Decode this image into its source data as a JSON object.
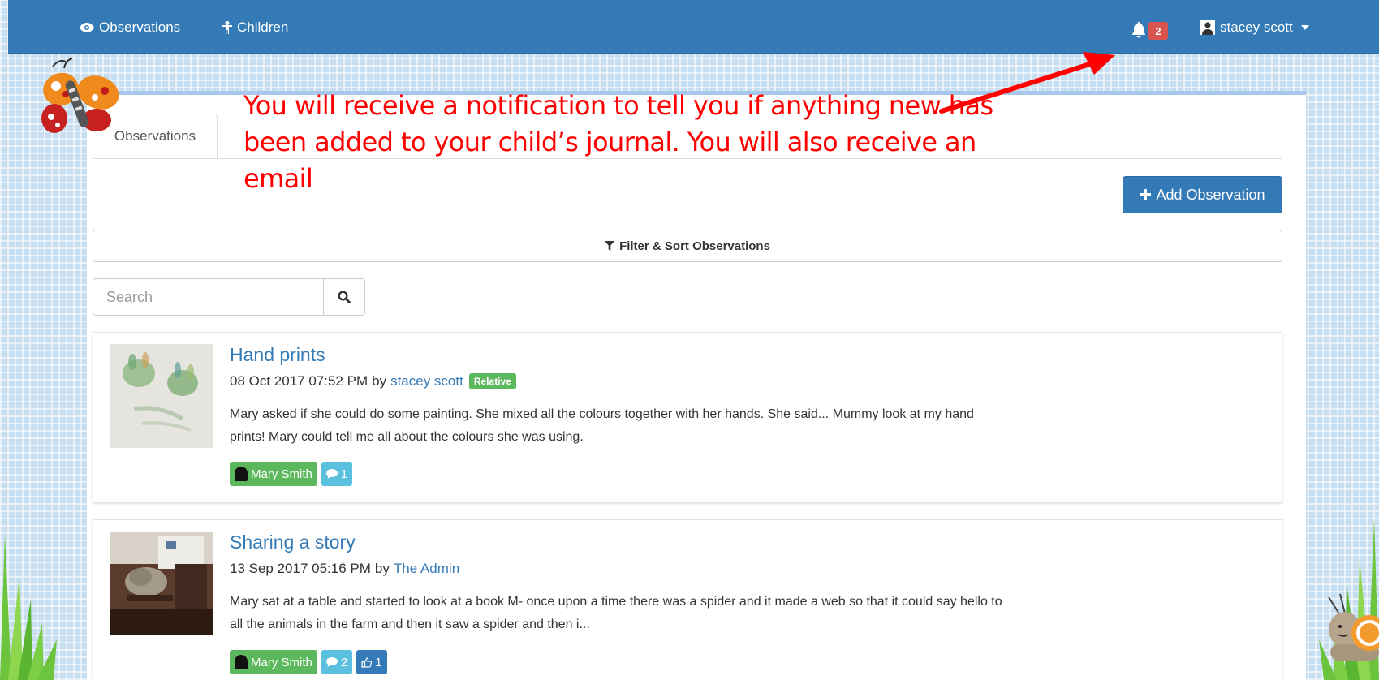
{
  "navbar": {
    "observations_label": "Observations",
    "children_label": "Children",
    "notification_count": "2",
    "user_name": "stacey scott"
  },
  "tabs": {
    "active_label": "Observations"
  },
  "toolbar": {
    "add_label": "Add Observation",
    "filter_label": "Filter & Sort Observations"
  },
  "search": {
    "placeholder": "Search",
    "value": ""
  },
  "annotation": {
    "text": "You will receive a notification to tell you if anything new has been added to your child’s journal. You will also receive an email"
  },
  "observations": [
    {
      "title": "Hand prints",
      "date": "08 Oct 2017 07:52 PM",
      "by": "by",
      "author": "stacey scott",
      "role_badge": "Relative",
      "body": "Mary asked if she could do some painting. She mixed all the colours together with her hands. She said... Mummy look at my hand prints! Mary could tell me all about the colours she was using.",
      "child": "Mary Smith",
      "comments": "1"
    },
    {
      "title": "Sharing a story",
      "date": "13 Sep 2017 05:16 PM",
      "by": "by",
      "author": "The Admin",
      "body": "Mary sat at a table and started to look at a book M- once upon a time there was a spider and it made a web so that it could say hello to all the animals in the farm and then it saw a spider and then i...",
      "child": "Mary Smith",
      "comments": "2",
      "likes": "1"
    }
  ],
  "colors": {
    "primary": "#337ab7",
    "success": "#5cb85c",
    "info": "#5bc0de",
    "danger": "#d9534f",
    "annotation": "#ff0000"
  }
}
